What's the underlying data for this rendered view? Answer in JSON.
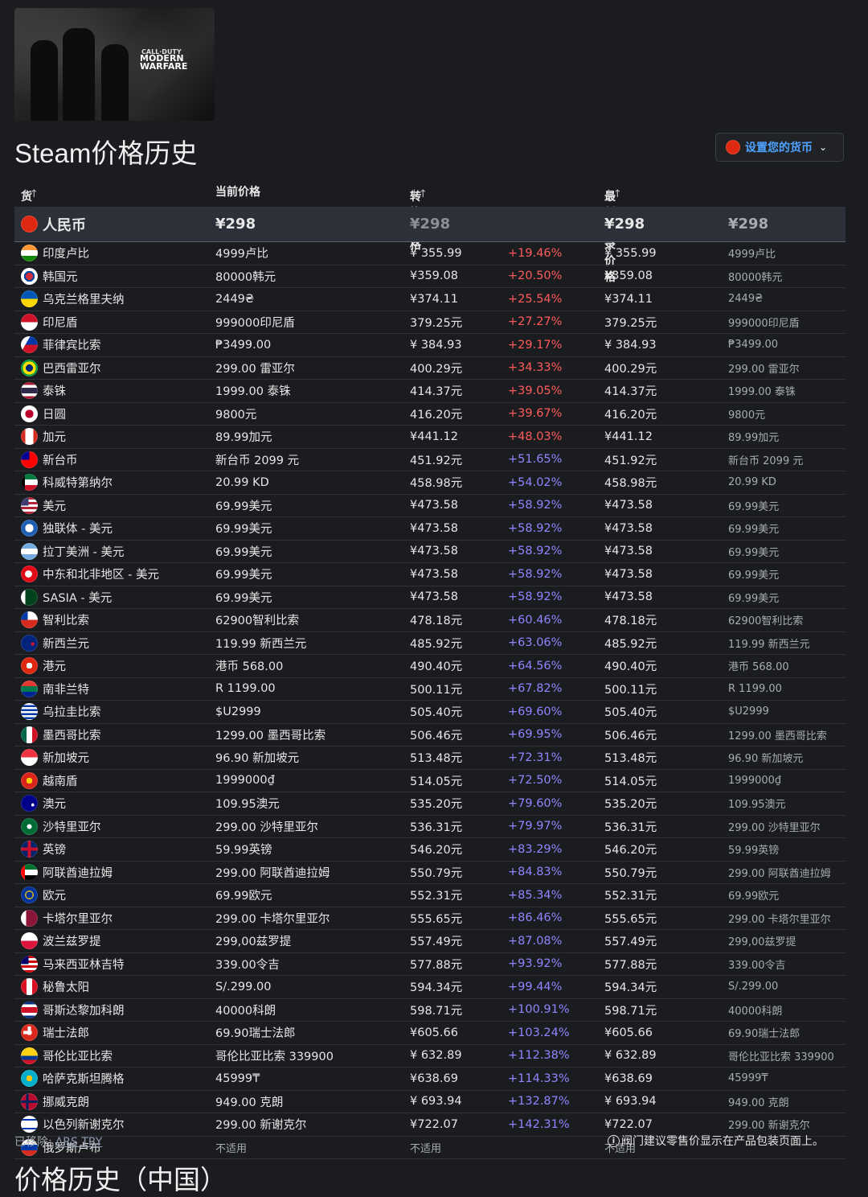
{
  "game": {
    "logo_line1": "CALL·DUTY",
    "logo_line2": "MODERN",
    "logo_line3": "WARFARE"
  },
  "title": "Steam价格历史",
  "currency_button": {
    "label": "设置您的货币",
    "flag_color": "#de2910"
  },
  "headers": {
    "currency": "货币",
    "current": "当前价格",
    "converted": "转换价格",
    "lowest": "最低记录价格",
    "sort_icon": "↓↑"
  },
  "first_row": {
    "name": "人民币",
    "current": "¥298",
    "converted": "¥298",
    "lowest": "¥298",
    "lowest_orig": "¥298",
    "flag": "#de2910"
  },
  "rows": [
    {
      "name": "印度卢比",
      "current": "4999卢比",
      "converted": "¥ 355.99",
      "pct": "+19.46%",
      "lowest": "¥ 355.99",
      "lowest_orig": "4999卢比",
      "flag": "linear-gradient(#ff9933 0 33%,#fff 33% 66%,#138808 66%)"
    },
    {
      "name": "韩国元",
      "current": "80000韩元",
      "converted": "¥359.08",
      "pct": "+20.50%",
      "lowest": "¥359.08",
      "lowest_orig": "80000韩元",
      "flag": "radial-gradient(circle,#cd2e3a 0 30%,#0047a0 30% 45%,#fff 45%)"
    },
    {
      "name": "乌克兰格里夫纳",
      "current": "2449₴",
      "converted": "¥374.11",
      "pct": "+25.54%",
      "lowest": "¥374.11",
      "lowest_orig": "2449₴",
      "flag": "linear-gradient(#0057b7 0 50%,#ffd700 50%)"
    },
    {
      "name": "印尼盾",
      "current": "999000印尼盾",
      "converted": "379.25元",
      "pct": "+27.27%",
      "lowest": "379.25元",
      "lowest_orig": "999000印尼盾",
      "flag": "linear-gradient(#ce1126 0 50%,#fff 50%)"
    },
    {
      "name": "菲律宾比索",
      "current": "₱3499.00",
      "converted": "¥ 384.93",
      "pct": "+29.17%",
      "lowest": "¥ 384.93",
      "lowest_orig": "₱3499.00",
      "flag": "linear-gradient(120deg,#fff 0 35%,transparent 35%),linear-gradient(#0038a8 0 50%,#ce1126 50%)"
    },
    {
      "name": "巴西雷亚尔",
      "current": "299.00 雷亚尔",
      "converted": "400.29元",
      "pct": "+34.33%",
      "lowest": "400.29元",
      "lowest_orig": "299.00 雷亚尔",
      "flag": "radial-gradient(circle,#002776 0 30%,#ffdf00 30% 55%,#009c3b 55%)"
    },
    {
      "name": "泰铢",
      "current": "1999.00 泰铢",
      "converted": "414.37元",
      "pct": "+39.05%",
      "lowest": "414.37元",
      "lowest_orig": "1999.00 泰铢",
      "flag": "linear-gradient(#a51931 0 17%,#fff 17% 33%,#2d2a4a 33% 67%,#fff 67% 83%,#a51931 83%)"
    },
    {
      "name": "日圆",
      "current": "9800元",
      "converted": "416.20元",
      "pct": "+39.67%",
      "lowest": "416.20元",
      "lowest_orig": "9800元",
      "flag": "radial-gradient(circle,#bc002d 0 35%,#fff 35%)"
    },
    {
      "name": "加元",
      "current": "89.99加元",
      "converted": "¥441.12",
      "pct": "+48.03%",
      "lowest": "¥441.12",
      "lowest_orig": "89.99加元",
      "flag": "linear-gradient(90deg,#d52b1e 0 25%,#fff 25% 75%,#d52b1e 75%)"
    },
    {
      "name": "新台币",
      "current": "新台币 2099 元",
      "converted": "451.92元",
      "pct": "+51.65%",
      "lowest": "451.92元",
      "lowest_orig": "新台币 2099 元",
      "flag": "linear-gradient(90deg,#000095 0 50%,transparent 50%) 0 0/100% 50% no-repeat,#fe0000"
    },
    {
      "name": "科威特第纳尔",
      "current": "20.99 KD",
      "converted": "458.98元",
      "pct": "+54.02%",
      "lowest": "458.98元",
      "lowest_orig": "20.99 KD",
      "flag": "linear-gradient(90deg,#000 0 25%,transparent 25%),linear-gradient(#007a3d 0 33%,#fff 33% 66%,#ce1126 66%)"
    },
    {
      "name": "美元",
      "current": "69.99美元",
      "converted": "¥473.58",
      "pct": "+58.92%",
      "lowest": "¥473.58",
      "lowest_orig": "69.99美元",
      "flag": "linear-gradient(90deg,#3c3b6e 0 45%,transparent 45%) 0 0/100% 50% no-repeat,repeating-linear-gradient(#b22234 0 3px,#fff 3px 6px)"
    },
    {
      "name": "独联体 - 美元",
      "current": "69.99美元",
      "converted": "¥473.58",
      "pct": "+58.92%",
      "lowest": "¥473.58",
      "lowest_orig": "69.99美元",
      "flag": "radial-gradient(circle,#fff 0 35%,#1e5fb4 35%)"
    },
    {
      "name": "拉丁美洲 - 美元",
      "current": "69.99美元",
      "converted": "¥473.58",
      "pct": "+58.92%",
      "lowest": "¥473.58",
      "lowest_orig": "69.99美元",
      "flag": "linear-gradient(#74acdf 0 33%,#fff 33% 66%,#74acdf 66%)"
    },
    {
      "name": "中东和北非地区 - 美元",
      "current": "69.99美元",
      "converted": "¥473.58",
      "pct": "+58.92%",
      "lowest": "¥473.58",
      "lowest_orig": "69.99美元",
      "flag": "radial-gradient(circle at 45% 50%,#fff 0 28%,#e30a17 28%)"
    },
    {
      "name": "SASIA - 美元",
      "current": "69.99美元",
      "converted": "¥473.58",
      "pct": "+58.92%",
      "lowest": "¥473.58",
      "lowest_orig": "69.99美元",
      "flag": "linear-gradient(90deg,#fff 0 25%,#01411c 25%)"
    },
    {
      "name": "智利比索",
      "current": "62900智利比索",
      "converted": "478.18元",
      "pct": "+60.46%",
      "lowest": "478.18元",
      "lowest_orig": "62900智利比索",
      "flag": "linear-gradient(90deg,#0039a6 0 40%,transparent 40%) 0 0/100% 50% no-repeat,linear-gradient(#fff 0 50%,#d52b1e 50%)"
    },
    {
      "name": "新西兰元",
      "current": "119.99 新西兰元",
      "converted": "485.92元",
      "pct": "+63.06%",
      "lowest": "485.92元",
      "lowest_orig": "119.99 新西兰元",
      "flag": "radial-gradient(circle at 70% 55%,#cc142b 0 12%,#00247d 12%)"
    },
    {
      "name": "港元",
      "current": "港币 568.00",
      "converted": "490.40元",
      "pct": "+64.56%",
      "lowest": "490.40元",
      "lowest_orig": "港币 568.00",
      "flag": "radial-gradient(circle,#fff 0 25%,#de2910 25%)"
    },
    {
      "name": "南非兰特",
      "current": "R 1199.00",
      "converted": "500.11元",
      "pct": "+67.82%",
      "lowest": "500.11元",
      "lowest_orig": "R 1199.00",
      "flag": "linear-gradient(#de3831 0 33%,#007a4d 33% 66%,#002395 66%)"
    },
    {
      "name": "乌拉圭比索",
      "current": "$U2999",
      "converted": "505.40元",
      "pct": "+69.60%",
      "lowest": "505.40元",
      "lowest_orig": "$U2999",
      "flag": "repeating-linear-gradient(#fff 0 2.5px,#0038a8 2.5px 5px)"
    },
    {
      "name": "墨西哥比索",
      "current": "1299.00 墨西哥比索",
      "converted": "506.46元",
      "pct": "+69.95%",
      "lowest": "506.46元",
      "lowest_orig": "1299.00 墨西哥比索",
      "flag": "linear-gradient(90deg,#006847 0 33%,#fff 33% 66%,#ce1126 66%)"
    },
    {
      "name": "新加坡元",
      "current": "96.90 新加坡元",
      "converted": "513.48元",
      "pct": "+72.31%",
      "lowest": "513.48元",
      "lowest_orig": "96.90 新加坡元",
      "flag": "linear-gradient(#ef3340 0 50%,#fff 50%)"
    },
    {
      "name": "越南盾",
      "current": "1999000₫",
      "converted": "514.05元",
      "pct": "+72.50%",
      "lowest": "514.05元",
      "lowest_orig": "1999000₫",
      "flag": "radial-gradient(circle,#ffcd00 0 25%,#da251d 25%)"
    },
    {
      "name": "澳元",
      "current": "109.95澳元",
      "converted": "535.20元",
      "pct": "+79.60%",
      "lowest": "535.20元",
      "lowest_orig": "109.95澳元",
      "flag": "radial-gradient(circle at 70% 60%,#fff 0 10%,#00008b 10%)"
    },
    {
      "name": "沙特里亚尔",
      "current": "299.00 沙特里亚尔",
      "converted": "536.31元",
      "pct": "+79.97%",
      "lowest": "536.31元",
      "lowest_orig": "299.00 沙特里亚尔",
      "flag": "radial-gradient(ellipse,#fff 0 20%,#006c35 20%)"
    },
    {
      "name": "英镑",
      "current": "59.99英镑",
      "converted": "546.20元",
      "pct": "+83.29%",
      "lowest": "546.20元",
      "lowest_orig": "59.99英镑",
      "flag": "linear-gradient(90deg,transparent 40%,#c8102e 40% 60%,transparent 60%),linear-gradient(transparent 40%,#c8102e 40% 60%,transparent 60%),#012169"
    },
    {
      "name": "阿联酋迪拉姆",
      "current": "299.00 阿联酋迪拉姆",
      "converted": "550.79元",
      "pct": "+84.83%",
      "lowest": "550.79元",
      "lowest_orig": "299.00 阿联酋迪拉姆",
      "flag": "linear-gradient(90deg,#ff0000 0 25%,transparent 25%),linear-gradient(#00732f 0 33%,#fff 33% 66%,#000 66%)"
    },
    {
      "name": "欧元",
      "current": "69.99欧元",
      "converted": "552.31元",
      "pct": "+85.34%",
      "lowest": "552.31元",
      "lowest_orig": "69.99欧元",
      "flag": "radial-gradient(circle,#003399 0 28%,#ffcc00 28% 36%,#003399 36%)"
    },
    {
      "name": "卡塔尔里亚尔",
      "current": "299.00 卡塔尔里亚尔",
      "converted": "555.65元",
      "pct": "+86.46%",
      "lowest": "555.65元",
      "lowest_orig": "299.00 卡塔尔里亚尔",
      "flag": "linear-gradient(90deg,#fff 0 30%,#8a1538 30%)"
    },
    {
      "name": "波兰兹罗提",
      "current": "299,00兹罗提",
      "converted": "557.49元",
      "pct": "+87.08%",
      "lowest": "557.49元",
      "lowest_orig": "299,00兹罗提",
      "flag": "linear-gradient(#fff 0 50%,#dc143c 50%)"
    },
    {
      "name": "马来西亚林吉特",
      "current": "339.00令吉",
      "converted": "577.88元",
      "pct": "+93.92%",
      "lowest": "577.88元",
      "lowest_orig": "339.00令吉",
      "flag": "linear-gradient(90deg,#010066 0 45%,transparent 45%) 0 0/100% 50% no-repeat,repeating-linear-gradient(#cc0001 0 3px,#fff 3px 6px)"
    },
    {
      "name": "秘鲁太阳",
      "current": "S/.299.00",
      "converted": "594.34元",
      "pct": "+99.44%",
      "lowest": "594.34元",
      "lowest_orig": "S/.299.00",
      "flag": "linear-gradient(90deg,#d91023 0 33%,#fff 33% 66%,#d91023 66%)"
    },
    {
      "name": "哥斯达黎加科朗",
      "current": "40000科朗",
      "converted": "598.71元",
      "pct": "+100.91%",
      "lowest": "598.71元",
      "lowest_orig": "40000科朗",
      "flag": "linear-gradient(#002b7f 0 17%,#fff 17% 33%,#ce1126 33% 67%,#fff 67% 83%,#002b7f 83%)"
    },
    {
      "name": "瑞士法郎",
      "current": "69.90瑞士法郎",
      "converted": "¥605.66",
      "pct": "+103.24%",
      "lowest": "¥605.66",
      "lowest_orig": "69.90瑞士法郎",
      "flag": "linear-gradient(90deg,transparent 40%,#fff 40% 60%,transparent 60%) 0 25%/100% 50% no-repeat,linear-gradient(transparent 40%,#fff 40% 60%,transparent 60%) 25% 0/50% 100% no-repeat,#da291c"
    },
    {
      "name": "哥伦比亚比索",
      "current": "哥伦比亚比索 339900",
      "converted": "¥ 632.89",
      "pct": "+112.38%",
      "lowest": "¥ 632.89",
      "lowest_orig": "哥伦比亚比索 339900",
      "flag": "linear-gradient(#fcd116 0 50%,#003893 50% 75%,#ce1126 75%)"
    },
    {
      "name": "哈萨克斯坦腾格",
      "current": "45999₸",
      "converted": "¥638.69",
      "pct": "+114.33%",
      "lowest": "¥638.69",
      "lowest_orig": "45999₸",
      "flag": "radial-gradient(circle,#fec50c 0 25%,#00afca 25%)"
    },
    {
      "name": "挪威克朗",
      "current": "949.00 克朗",
      "converted": "¥ 693.94",
      "pct": "+132.87%",
      "lowest": "¥ 693.94",
      "lowest_orig": "949.00 克朗",
      "flag": "linear-gradient(90deg,transparent 30%,#00205b 30% 45%,transparent 45%),linear-gradient(transparent 42%,#00205b 42% 58%,transparent 58%),#ba0c2f"
    },
    {
      "name": "以色列新谢克尔",
      "current": "299.00 新谢克尔",
      "converted": "¥722.07",
      "pct": "+142.31%",
      "lowest": "¥722.07",
      "lowest_orig": "299.00 新谢克尔",
      "flag": "linear-gradient(#fff 0 18%,#0038b8 18% 28%,#fff 28% 72%,#0038b8 72% 82%,#fff 82%)"
    },
    {
      "name": "俄罗斯卢布",
      "current": "不适用",
      "converted": "不适用",
      "pct": "",
      "lowest": "不适用",
      "lowest_orig": "",
      "flag": "linear-gradient(#fff 0 33%,#0039a6 33% 66%,#d52b1e 66%)"
    }
  ],
  "footer": {
    "removed_label": "已移除:",
    "removed_value": "ARS TRY",
    "note": "阀门建议零售价显示在产品包装页面上。",
    "info_glyph": "i"
  },
  "section_title": "价格历史（中国）"
}
